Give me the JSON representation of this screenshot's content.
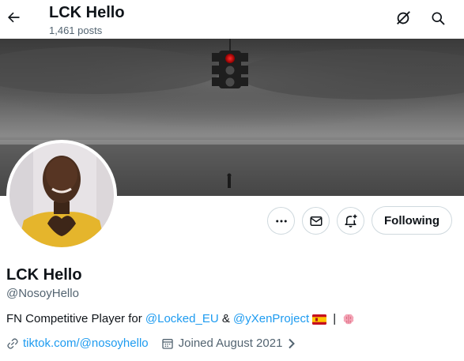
{
  "header": {
    "title": "LCK Hello",
    "posts_count": "1,461 posts",
    "back_icon": "arrow-left-icon",
    "grok_icon": "grok-icon",
    "search_icon": "search-icon"
  },
  "banner": {
    "description_icon": "traffic-light-banner"
  },
  "actions": {
    "more_icon": "more-icon",
    "message_icon": "envelope-icon",
    "notify_icon": "bell-plus-icon",
    "following_label": "Following"
  },
  "profile": {
    "name": "LCK Hello",
    "handle": "@NosoyHello",
    "bio_prefix": "FN Competitive Player for ",
    "bio_mention1": "@Locked_EU",
    "bio_amp": " & ",
    "bio_mention2": "@yXenProject",
    "bio_sep": " | ",
    "website": "tiktok.com/@nosoyhello",
    "joined": "Joined August 2021"
  },
  "colors": {
    "accent": "#1d9bf0",
    "secondary_text": "#536471",
    "border": "#cfd9de"
  }
}
